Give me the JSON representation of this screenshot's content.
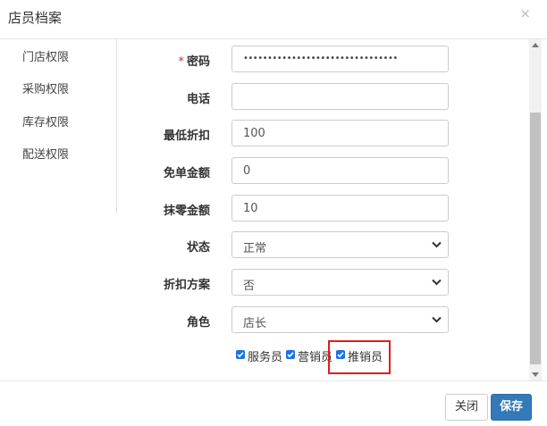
{
  "dialog": {
    "title": "店员档案",
    "close_symbol": "×"
  },
  "nav": {
    "items": [
      {
        "label": "门店权限"
      },
      {
        "label": "采购权限"
      },
      {
        "label": "库存权限"
      },
      {
        "label": "配送权限"
      }
    ]
  },
  "form": {
    "password": {
      "label": "密码",
      "required_mark": "*",
      "value": "••••••••••••••••••••••••••••••••"
    },
    "phone": {
      "label": "电话",
      "value": ""
    },
    "min_discount": {
      "label": "最低折扣",
      "value": "100"
    },
    "free_amount": {
      "label": "免单金额",
      "value": "0"
    },
    "round_amount": {
      "label": "抹零金额",
      "value": "10"
    },
    "status": {
      "label": "状态",
      "value": "正常"
    },
    "discount_plan": {
      "label": "折扣方案",
      "value": "否"
    },
    "role": {
      "label": "角色",
      "value": "店长"
    },
    "checkboxes": [
      {
        "label": "服务员",
        "checked": true
      },
      {
        "label": "营销员",
        "checked": true
      },
      {
        "label": "推销员",
        "checked": true
      }
    ]
  },
  "footer": {
    "close_label": "关闭",
    "save_label": "保存"
  },
  "colors": {
    "primary": "#337ab7",
    "highlight": "#e31b1b",
    "checkbox": "#1a73e8"
  }
}
